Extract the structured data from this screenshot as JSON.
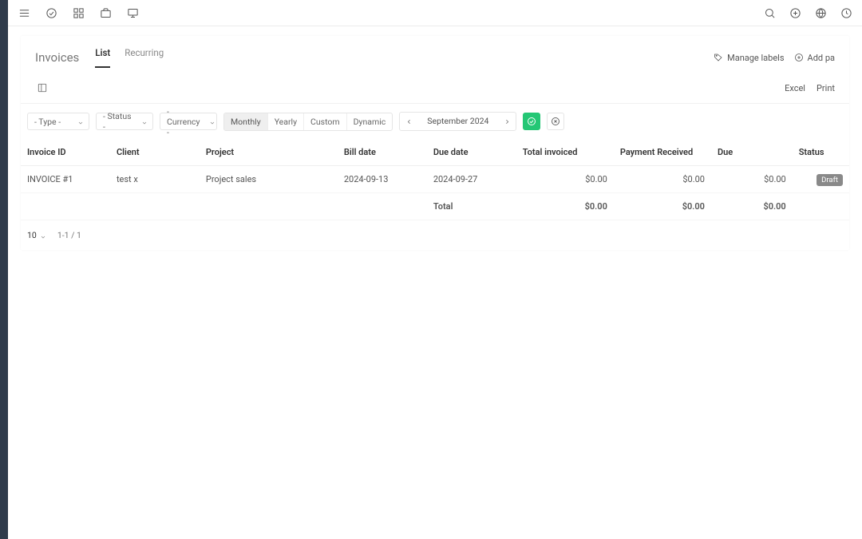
{
  "page": {
    "title": "Invoices"
  },
  "tabs": {
    "list": "List",
    "recurring": "Recurring"
  },
  "header_actions": {
    "manage_labels": "Manage labels",
    "add_payment": "Add pa"
  },
  "export": {
    "excel": "Excel",
    "print": "Print"
  },
  "filters": {
    "type": "- Type -",
    "status": "- Status -",
    "currency": "- Currency -"
  },
  "range": {
    "monthly": "Monthly",
    "yearly": "Yearly",
    "custom": "Custom",
    "dynamic": "Dynamic"
  },
  "period": {
    "label": "September 2024"
  },
  "columns": {
    "invoice_id": "Invoice ID",
    "client": "Client",
    "project": "Project",
    "bill_date": "Bill date",
    "due_date": "Due date",
    "total_invoiced": "Total invoiced",
    "payment_received": "Payment Received",
    "due": "Due",
    "status": "Status"
  },
  "rows": [
    {
      "invoice_id": "INVOICE #1",
      "client": "test x",
      "project": "Project sales",
      "bill_date": "2024-09-13",
      "due_date": "2024-09-27",
      "total_invoiced": "$0.00",
      "payment_received": "$0.00",
      "due": "$0.00",
      "status": "Draft"
    }
  ],
  "totals": {
    "label": "Total",
    "total_invoiced": "$0.00",
    "payment_received": "$0.00",
    "due": "$0.00"
  },
  "pager": {
    "page_size": "10",
    "range": "1-1 / 1"
  }
}
